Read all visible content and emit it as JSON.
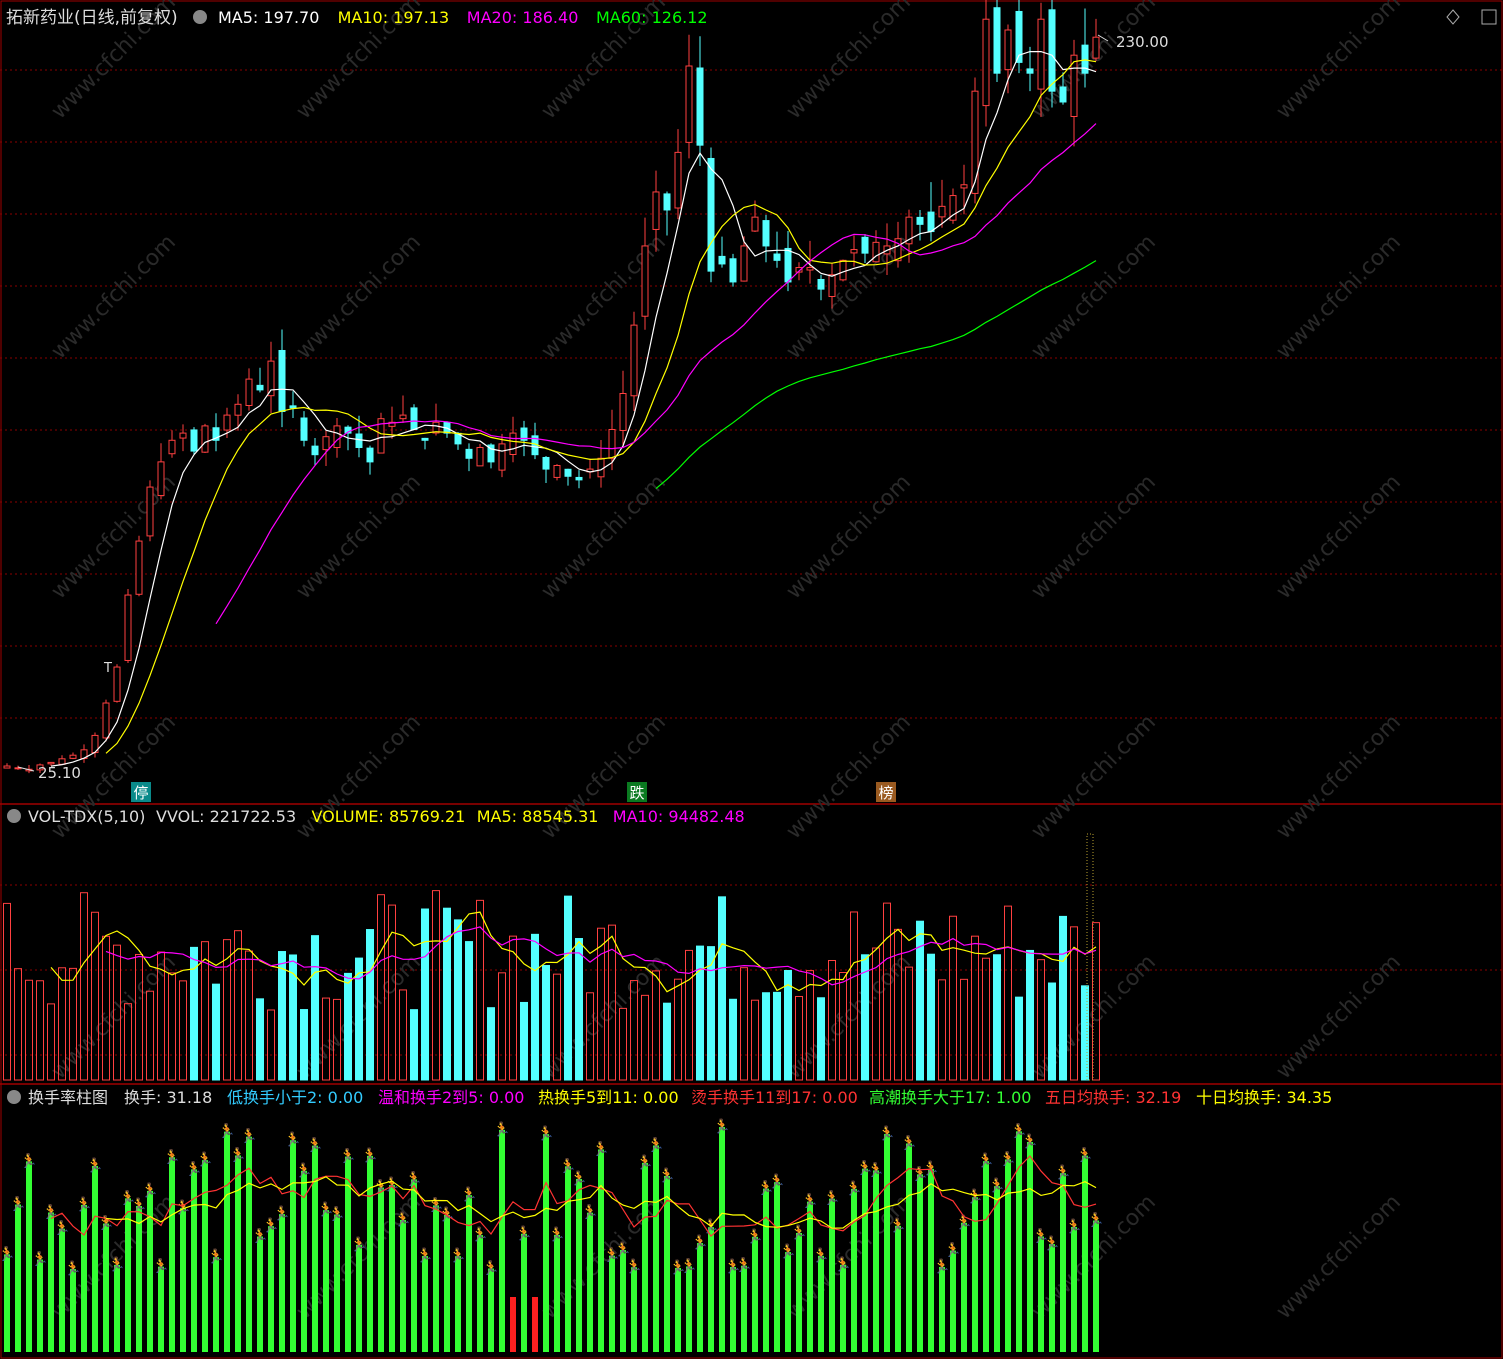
{
  "app": {
    "title": "拓新药业(日线,前复权)",
    "ma_labels": [
      {
        "text": "MA5: 197.70",
        "color": "#ffffff"
      },
      {
        "text": "MA10: 197.13",
        "color": "#ffff00"
      },
      {
        "text": "MA20: 186.40",
        "color": "#ff00ff"
      },
      {
        "text": "MA60: 126.12",
        "color": "#00ff00"
      }
    ],
    "price_high_label": "230.00",
    "price_low_label": "25.10",
    "price_marker_T": "T",
    "event_markers": [
      {
        "text": "停",
        "bg": "#0a8a8a"
      },
      {
        "text": "跌",
        "bg": "#0a7a20"
      },
      {
        "text": "榜",
        "bg": "#9a5a20"
      }
    ]
  },
  "vol_panel": {
    "name": "VOL-TDX(5,10)",
    "labels": [
      {
        "text": "VVOL: 221722.53",
        "color": "#dddddd"
      },
      {
        "text": "VOLUME: 85769.21",
        "color": "#ffff00"
      },
      {
        "text": "MA5: 88545.31",
        "color": "#ffff00"
      },
      {
        "text": "MA10: 94482.48",
        "color": "#ff00ff"
      }
    ]
  },
  "turnover_panel": {
    "name": "换手率柱图",
    "labels": [
      {
        "text": "换手: 31.18",
        "color": "#dddddd"
      },
      {
        "text": "低换手小于2: 0.00",
        "color": "#33ccff"
      },
      {
        "text": "温和换手2到5: 0.00",
        "color": "#ff00ff"
      },
      {
        "text": "热换手5到11: 0.00",
        "color": "#ffff00"
      },
      {
        "text": "烫手换手11到17: 0.00",
        "color": "#ff3333"
      },
      {
        "text": "高潮换手大于17: 1.00",
        "color": "#33ff33"
      },
      {
        "text": "五日均换手: 32.19",
        "color": "#ff3333"
      },
      {
        "text": "十日均换手: 34.35",
        "color": "#ffff00"
      }
    ]
  },
  "colors": {
    "up": "#ff4040",
    "down": "#54ffff",
    "ma5": "#ffffff",
    "ma10": "#ffff00",
    "ma20": "#ff00ff",
    "ma60": "#00ff00",
    "grid": "#8a0000",
    "border": "#a00000",
    "turnover_bar": "#33ff33",
    "turnover_low_bar": "#ff2020"
  },
  "chart_data": {
    "type": "candlestick",
    "close_values": [
      27.5,
      27,
      26.6,
      27.8,
      28.5,
      29.5,
      30.5,
      32,
      36,
      45,
      55,
      75,
      90,
      105,
      112,
      118,
      120,
      115,
      122,
      118,
      125,
      128,
      135,
      132,
      140,
      126,
      127,
      118,
      114,
      119,
      122,
      120,
      116,
      112,
      124,
      123,
      125,
      121,
      118,
      123,
      120,
      117,
      113,
      116,
      112,
      117,
      120,
      118,
      114,
      110,
      111,
      108,
      107,
      110,
      113,
      121,
      131,
      150,
      172,
      187,
      182,
      198,
      222,
      200,
      165,
      167,
      162,
      172,
      180,
      172,
      168,
      162,
      166,
      166,
      160,
      164,
      168,
      171,
      170,
      173,
      172,
      174,
      180,
      178,
      176,
      183,
      186,
      189,
      215,
      235,
      220,
      232,
      223,
      220,
      235,
      215,
      212,
      225,
      220,
      230
    ]
  }
}
